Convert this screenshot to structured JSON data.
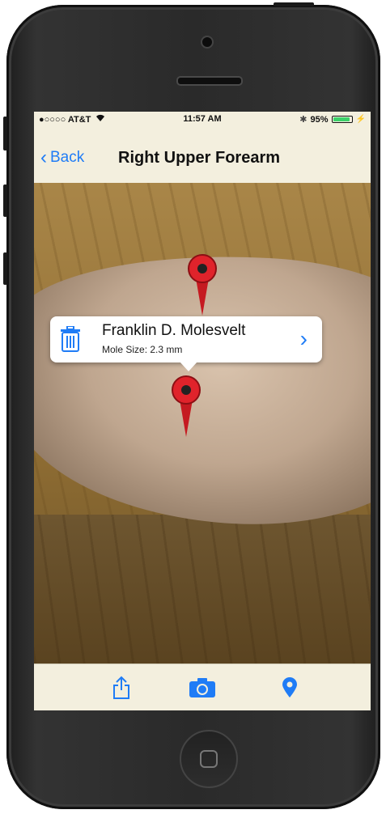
{
  "status_bar": {
    "carrier": "●○○○○ AT&T",
    "wifi_icon": "wifi-icon",
    "time": "11:57 AM",
    "bluetooth_icon": "bluetooth-icon",
    "battery_percent": "95%",
    "battery_level": 0.95
  },
  "nav": {
    "back_label": "Back",
    "title": "Right Upper Forearm"
  },
  "callout": {
    "name": "Franklin D. Molesvelt",
    "detail": "Mole Size: 2.3 mm",
    "delete_icon": "trash-icon",
    "disclosure_icon": "chevron-right-icon"
  },
  "toolbar": {
    "share_icon": "share-icon",
    "camera_icon": "camera-icon",
    "pin_icon": "location-pin-icon"
  },
  "colors": {
    "accent": "#1f7cf6",
    "pin_red": "#e0232b",
    "bar_background": "#f3efde"
  }
}
